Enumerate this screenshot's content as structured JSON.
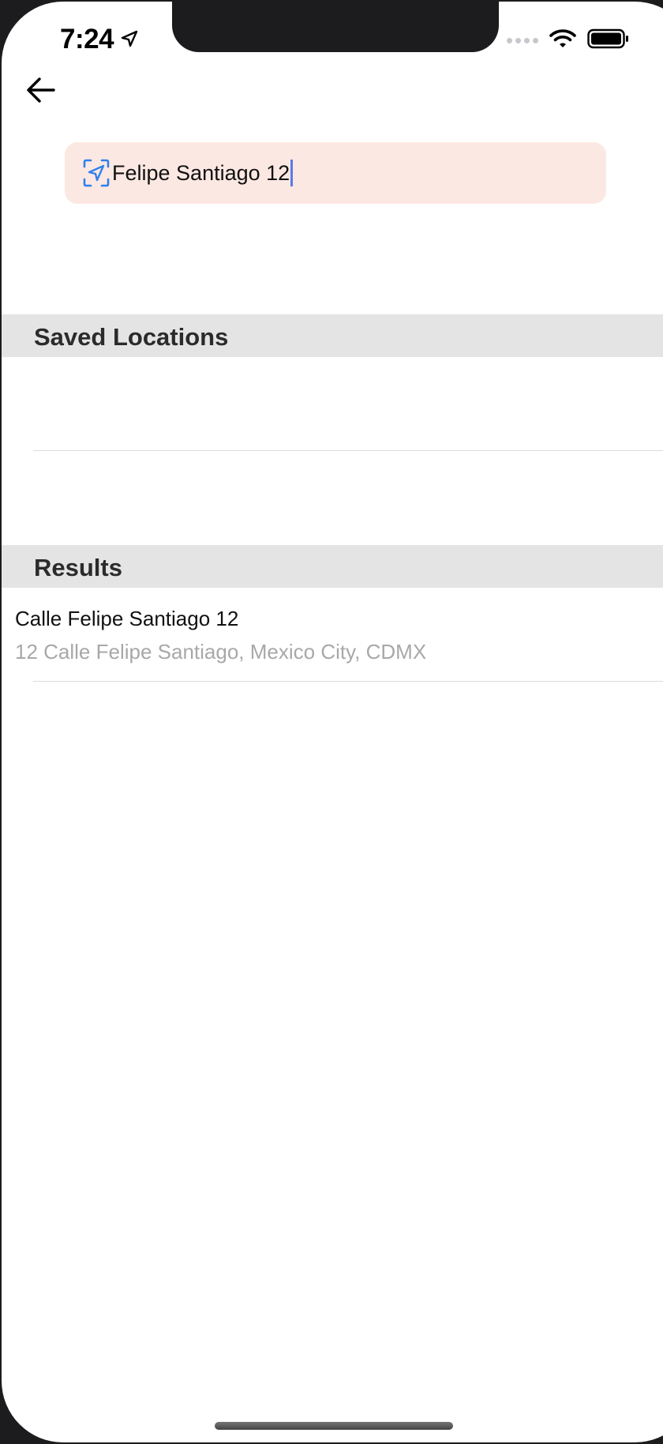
{
  "status_bar": {
    "time": "7:24",
    "icons": [
      "location-arrow-icon",
      "cellular-dots-icon",
      "wifi-icon",
      "battery-icon"
    ]
  },
  "nav": {
    "back_icon": "arrow-left-icon"
  },
  "search": {
    "icon": "location-target-icon",
    "value": "Felipe Santiago 12",
    "accent_color": "#2f80ed",
    "background_color": "#fce8e2"
  },
  "sections": {
    "saved_locations": {
      "title": "Saved Locations",
      "items": []
    },
    "results": {
      "title": "Results",
      "items": [
        {
          "title": "Calle Felipe Santiago 12",
          "subtitle": "12 Calle Felipe Santiago, Mexico City, CDMX"
        }
      ]
    }
  }
}
